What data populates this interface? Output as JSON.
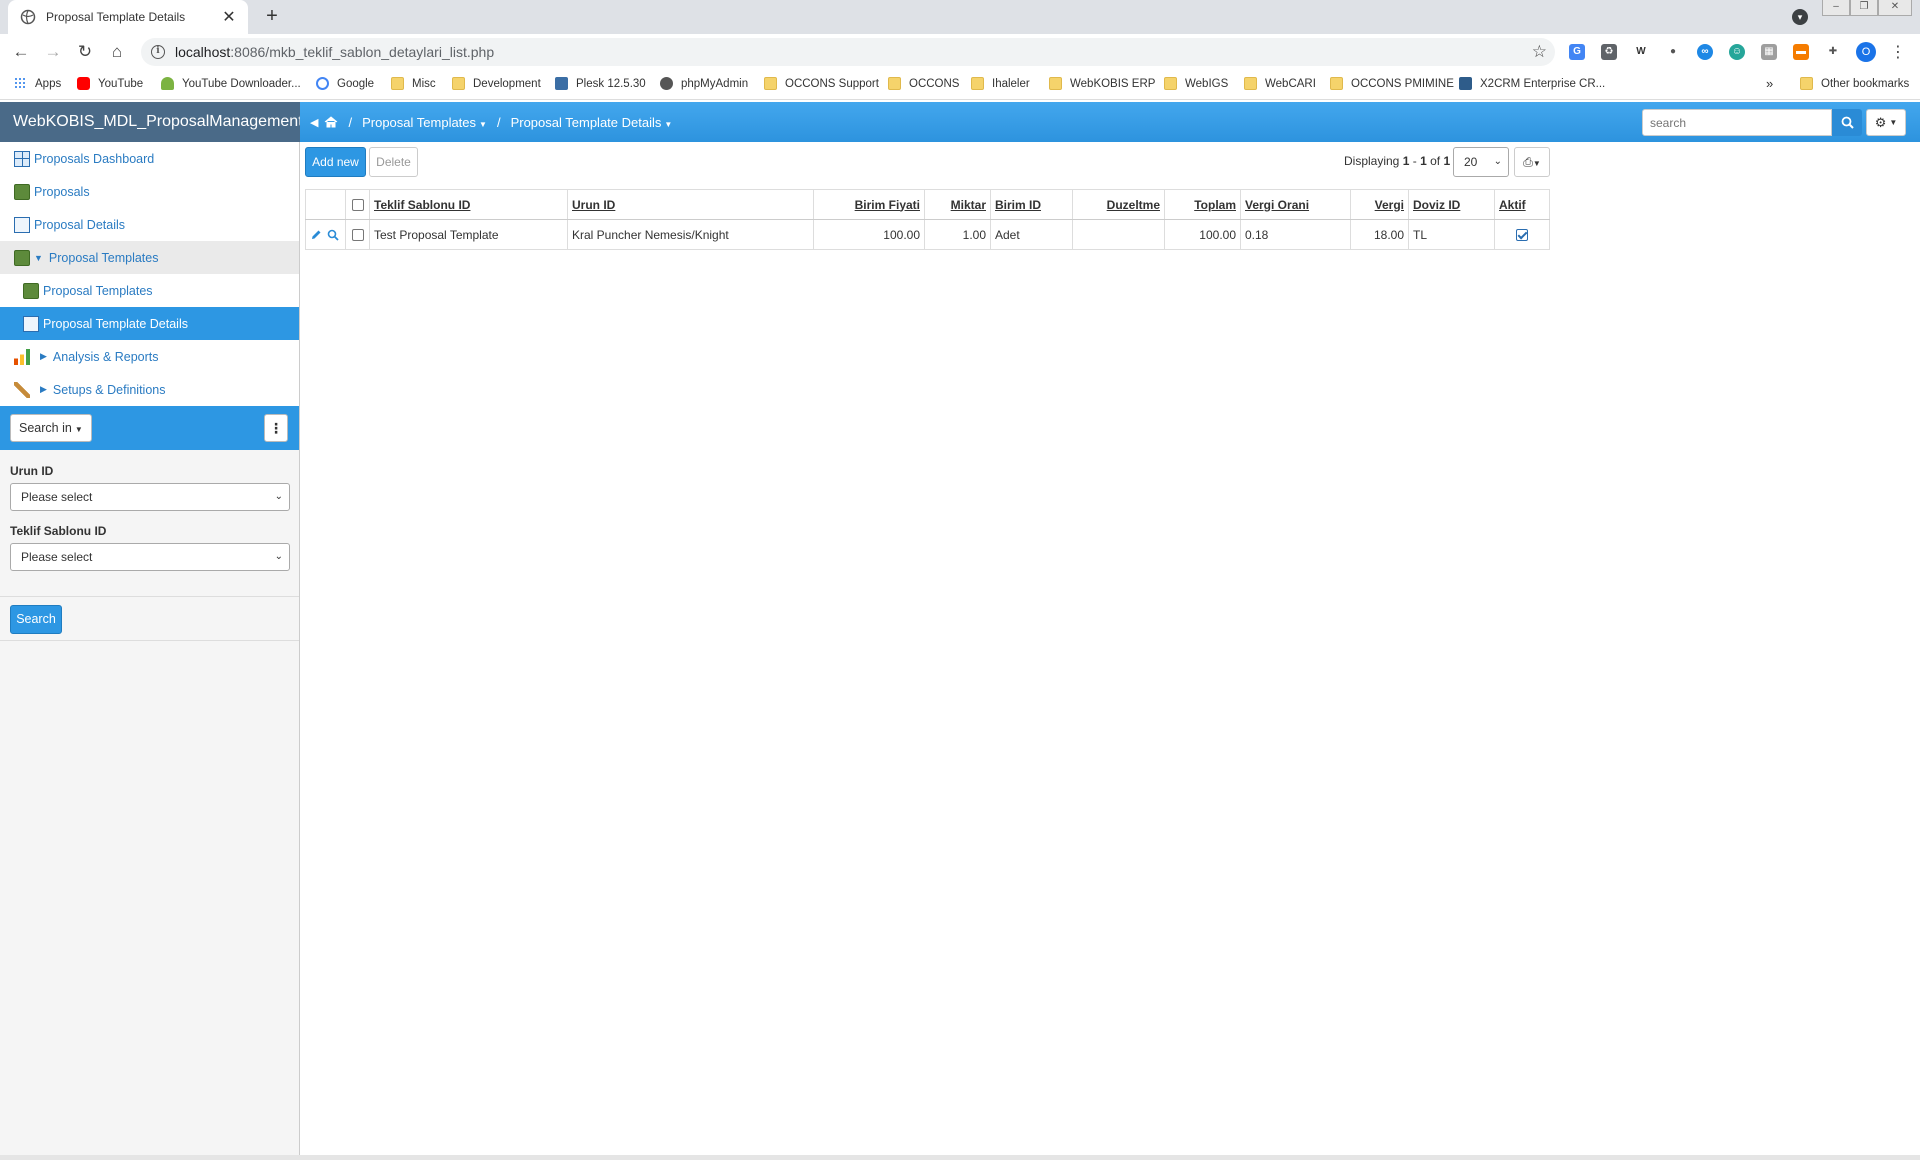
{
  "browser": {
    "tab_title": "Proposal Template Details",
    "url_host": "localhost",
    "url_path": ":8086/mkb_teklif_sablon_detaylari_list.php",
    "profile_initial": "O",
    "bookmarks": [
      {
        "label": "Apps",
        "icon": "apps"
      },
      {
        "label": "YouTube",
        "icon": "yt"
      },
      {
        "label": "YouTube Downloader...",
        "icon": "dl"
      },
      {
        "label": "Google",
        "icon": "g"
      },
      {
        "label": "Misc",
        "icon": "folder"
      },
      {
        "label": "Development",
        "icon": "folder"
      },
      {
        "label": "Plesk 12.5.30",
        "icon": "plesk"
      },
      {
        "label": "phpMyAdmin",
        "icon": "pma"
      },
      {
        "label": "OCCONS Support",
        "icon": "folder"
      },
      {
        "label": "OCCONS",
        "icon": "folder"
      },
      {
        "label": "Ihaleler",
        "icon": "folder"
      },
      {
        "label": "WebKOBIS ERP",
        "icon": "folder"
      },
      {
        "label": "WebIGS",
        "icon": "folder"
      },
      {
        "label": "WebCARI",
        "icon": "folder"
      },
      {
        "label": "OCCONS PMIMINE",
        "icon": "folder"
      },
      {
        "label": "X2CRM Enterprise CR...",
        "icon": "x2"
      }
    ],
    "other_bookmarks": "Other bookmarks",
    "more": "»"
  },
  "app": {
    "brand": "WebKOBIS_MDL_ProposalManagement",
    "breadcrumb": {
      "level1": "Proposal Templates",
      "level2": "Proposal Template Details",
      "sep": "/"
    },
    "search_placeholder": "search"
  },
  "sidebar": {
    "items": [
      {
        "label": "Proposals Dashboard"
      },
      {
        "label": "Proposals"
      },
      {
        "label": "Proposal Details"
      },
      {
        "label": "Proposal Templates"
      },
      {
        "label": "Proposal Templates"
      },
      {
        "label": "Proposal Template Details"
      },
      {
        "label": "Analysis & Reports"
      },
      {
        "label": "Setups & Definitions"
      }
    ],
    "search_in": "Search in",
    "filters": [
      {
        "label": "Urun ID",
        "value": "Please select"
      },
      {
        "label": "Teklif Sablonu ID",
        "value": "Please select"
      }
    ],
    "search_button": "Search"
  },
  "main": {
    "add_new": "Add new",
    "delete": "Delete",
    "displaying_prefix": "Displaying",
    "range_from": "1",
    "range_dash": " - ",
    "range_to": "1",
    "of": " of ",
    "total": "1",
    "page_size": "20",
    "columns": [
      "Teklif Sablonu ID",
      "Urun ID",
      "Birim Fiyati",
      "Miktar",
      "Birim ID",
      "Duzeltme",
      "Toplam",
      "Vergi Orani",
      "Vergi",
      "Doviz ID",
      "Aktif"
    ],
    "rows": [
      {
        "teklif_sablonu_id": "Test Proposal Template",
        "urun_id": "Kral Puncher Nemesis/Knight",
        "birim_fiyati": "100.00",
        "miktar": "1.00",
        "birim_id": "Adet",
        "duzeltme": "",
        "toplam": "100.00",
        "vergi_orani": "0.18",
        "vergi": "18.00",
        "doviz_id": "TL",
        "aktif": true
      }
    ]
  },
  "colors": {
    "header_blue": "#2d97e3",
    "brand_bg": "#4a6a88",
    "link_blue": "#2a7bc2"
  }
}
